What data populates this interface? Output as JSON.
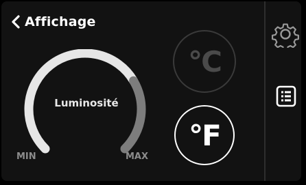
{
  "header": {
    "title": "Affichage",
    "back_icon": "chevron-left-icon"
  },
  "gauge": {
    "label": "Luminosité",
    "min_label": "MIN",
    "max_label": "MAX",
    "level": 0.72,
    "track_color": "#e6e6e6",
    "fill_color": "#7d7d7d"
  },
  "units": {
    "celsius_label": "°C",
    "fahrenheit_label": "°F",
    "selected": "fahrenheit"
  },
  "sidebar": {
    "settings_icon": "gear-icon",
    "menu_icon": "list-icon"
  },
  "colors": {
    "background": "#121212",
    "active": "#ffffff",
    "inactive": "#3a3a3a"
  }
}
